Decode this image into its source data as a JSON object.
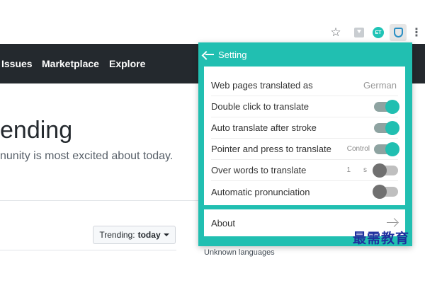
{
  "browser_toolbar": {
    "icons": [
      "star-icon",
      "download-extension-icon",
      "et-extension-icon",
      "translate-extension-icon",
      "menu-icon"
    ],
    "et_badge": "ET",
    "star_glyph": "☆",
    "menu_glyph": "⋮"
  },
  "github_header": {
    "nav": [
      "Issues",
      "Marketplace",
      "Explore"
    ]
  },
  "page": {
    "title": "ending",
    "subtitle": "nunity is most excited about today.",
    "trending_label": "Trending:",
    "trending_value": "today",
    "unknown_languages": "Unknown languages"
  },
  "popup": {
    "title": "Setting",
    "accent_color": "#21bfb1",
    "rows": [
      {
        "label": "Web pages translated as",
        "value": "German"
      },
      {
        "label": "Double click to translate",
        "toggle": "on"
      },
      {
        "label": "Auto translate after stroke",
        "toggle": "on"
      },
      {
        "label": "Pointer and press to translate",
        "hint": "Control",
        "toggle": "on"
      },
      {
        "label": "Over words to translate",
        "number": "1",
        "unit": "s",
        "toggle": "off"
      },
      {
        "label": "Automatic pronunciation",
        "toggle": "off"
      }
    ],
    "about_label": "About"
  },
  "watermark": "最需教育"
}
